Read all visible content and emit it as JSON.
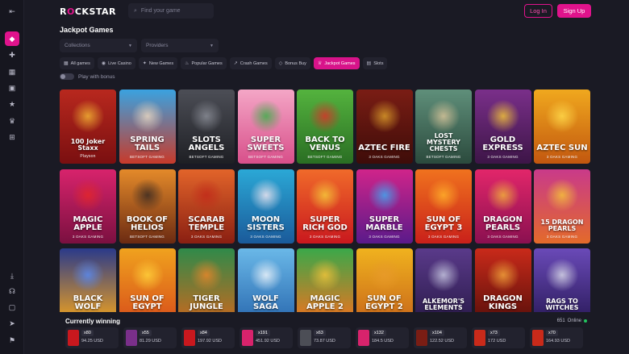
{
  "brand": {
    "logo_before": "R",
    "logo_o": "O",
    "logo_after": "CKSTAR",
    "accent": "#e0138c"
  },
  "header": {
    "search_placeholder": "Find your game",
    "login_label": "Log In",
    "signup_label": "Sign Up"
  },
  "sidebar": {
    "top_icons": [
      "collapse-icon",
      "home-icon",
      "puzzle-icon",
      "grid-icon",
      "gift-icon",
      "star-icon",
      "trophy-icon",
      "cart-icon"
    ],
    "bottom_icons": [
      "download-icon",
      "support-icon",
      "square-icon",
      "send-icon",
      "flag-icon"
    ]
  },
  "page_title": "Jackpot Games",
  "filters": {
    "collections_placeholder": "Collections",
    "providers_placeholder": "Providers"
  },
  "categories": [
    {
      "label": "All games",
      "icon": "grid",
      "active": false
    },
    {
      "label": "Live Casino",
      "icon": "live",
      "active": false
    },
    {
      "label": "New Games",
      "icon": "new",
      "active": false
    },
    {
      "label": "Popular Games",
      "icon": "fire",
      "active": false
    },
    {
      "label": "Crash Games",
      "icon": "crash",
      "active": false
    },
    {
      "label": "Bonus Buy",
      "icon": "diamond",
      "active": false
    },
    {
      "label": "Jackpot Games",
      "icon": "jackpot",
      "active": true
    },
    {
      "label": "Slots",
      "icon": "slots",
      "active": false
    }
  ],
  "bonus_toggle_label": "Play with bonus",
  "games": [
    {
      "name": "100 Joker Staxx",
      "provider": "Playson",
      "bg": "#b8281e",
      "bg2": "#7a0f10",
      "art": "#f2b233",
      "style": "plain"
    },
    {
      "name": "Spring Tails",
      "provider": "BETSOFT GAMING",
      "bg": "#3aa2e0",
      "bg2": "#c83a2a",
      "art": "#e8d6c0",
      "style": ""
    },
    {
      "name": "Slots Angels",
      "provider": "BETSOFT GAMING",
      "bg": "#4c4e56",
      "bg2": "#1e1f24",
      "art": "#8a8d96",
      "style": ""
    },
    {
      "name": "Super Sweets",
      "provider": "BETSOFT GAMING",
      "bg": "#f4a6c6",
      "bg2": "#d84f8a",
      "art": "#3fae4a",
      "style": ""
    },
    {
      "name": "Back to Venus",
      "provider": "BETSOFT GAMING",
      "bg": "#54b33e",
      "bg2": "#2a6e23",
      "art": "#d9332a",
      "style": ""
    },
    {
      "name": "Aztec Fire",
      "provider": "3 OAKS GAMING",
      "bg": "#7a1d14",
      "bg2": "#3e0c09",
      "art": "#d99b2a",
      "style": ""
    },
    {
      "name": "Lost Mystery Chests",
      "provider": "BETSOFT GAMING",
      "bg": "#5f8f7a",
      "bg2": "#2b4a3d",
      "art": "#d7c49a",
      "style": ""
    },
    {
      "name": "Gold Express",
      "provider": "3 OAKS GAMING",
      "bg": "#7a2f8a",
      "bg2": "#3d1547",
      "art": "#f0c23a",
      "style": ""
    },
    {
      "name": "Aztec Sun",
      "provider": "3 OAKS GAMING",
      "bg": "#f0a81e",
      "bg2": "#c2570f",
      "art": "#ffd94a",
      "style": ""
    },
    {
      "name": "Magic Apple",
      "provider": "3 OAKS GAMING",
      "bg": "#d8236c",
      "bg2": "#7a1040",
      "art": "#e3262a",
      "style": ""
    },
    {
      "name": "Book of Helios",
      "provider": "BETSOFT GAMING",
      "bg": "#e48a2a",
      "bg2": "#6b2a12",
      "art": "#3a2a22",
      "style": ""
    },
    {
      "name": "Scarab Temple",
      "provider": "3 OAKS GAMING",
      "bg": "#e2642a",
      "bg2": "#8a1f12",
      "art": "#c22a1a",
      "style": ""
    },
    {
      "name": "Moon Sisters",
      "provider": "3 OAKS GAMING",
      "bg": "#2ba8d6",
      "bg2": "#1a5a9a",
      "art": "#f1e6f0",
      "style": ""
    },
    {
      "name": "Super Rich God",
      "provider": "3 OAKS GAMING",
      "bg": "#f06a2a",
      "bg2": "#c9181e",
      "art": "#f5c93a",
      "style": ""
    },
    {
      "name": "Super Marble",
      "provider": "3 OAKS GAMING",
      "bg": "#d0248a",
      "bg2": "#5a1a8a",
      "art": "#3fa8f0",
      "style": ""
    },
    {
      "name": "Sun of Egypt 3",
      "provider": "3 OAKS GAMING",
      "bg": "#f0721e",
      "bg2": "#c9201a",
      "art": "#ffb02a",
      "style": ""
    },
    {
      "name": "Dragon Pearls",
      "provider": "3 OAKS GAMING",
      "bg": "#e2266a",
      "bg2": "#8a1050",
      "art": "#f0b03a",
      "style": ""
    },
    {
      "name": "15 Dragon Pearls",
      "provider": "3 OAKS GAMING",
      "bg": "#c93a8a",
      "bg2": "#e36a2a",
      "art": "#f5c23a",
      "style": ""
    },
    {
      "name": "Black Wolf",
      "provider": "3 OAKS GAMING",
      "bg": "#2a3a8a",
      "bg2": "#f0a21e",
      "art": "#5a8af0",
      "style": ""
    },
    {
      "name": "Sun of Egypt",
      "provider": "3 OAKS GAMING",
      "bg": "#f0a21e",
      "bg2": "#d8501a",
      "art": "#ffd03a",
      "style": ""
    },
    {
      "name": "Tiger Jungle",
      "provider": "3 OAKS GAMING",
      "bg": "#2f8a4a",
      "bg2": "#c9681e",
      "art": "#e8862a",
      "style": ""
    },
    {
      "name": "Wolf Saga",
      "provider": "3 OAKS GAMING",
      "bg": "#6ab8e8",
      "bg2": "#2a6ab0",
      "art": "#eef4fa",
      "style": ""
    },
    {
      "name": "Magic Apple 2",
      "provider": "3 OAKS GAMING",
      "bg": "#3aa84a",
      "bg2": "#f0721e",
      "art": "#f0c23a",
      "style": ""
    },
    {
      "name": "Sun of Egypt 2",
      "provider": "3 OAKS GAMING",
      "bg": "#f0b21e",
      "bg2": "#c9681a",
      "art": "#e89a2a",
      "style": ""
    },
    {
      "name": "Alkemor's Elements",
      "provider": "3 OAKS GAMING",
      "bg": "#5a3a8a",
      "bg2": "#2a1a4a",
      "art": "#c6c6e0",
      "style": ""
    },
    {
      "name": "Dragon Kings",
      "provider": "3 OAKS GAMING",
      "bg": "#c92a1a",
      "bg2": "#5a0f0a",
      "art": "#f0a23a",
      "style": ""
    },
    {
      "name": "Rags to Witches",
      "provider": "3 OAKS GAMING",
      "bg": "#6a4ab8",
      "bg2": "#2a1a5a",
      "art": "#d8d8e8",
      "style": ""
    }
  ],
  "winning": {
    "title": "Currently winning",
    "online_count": "651",
    "online_label": "Online",
    "items": [
      {
        "mult": "x80",
        "amount": "94.25 USD",
        "color": "#c9181e"
      },
      {
        "mult": "x55",
        "amount": "81.29 USD",
        "color": "#7a2f8a"
      },
      {
        "mult": "x84",
        "amount": "197.92 USD",
        "color": "#c9181e"
      },
      {
        "mult": "x191",
        "amount": "451.92 USD",
        "color": "#d8236c"
      },
      {
        "mult": "x63",
        "amount": "73.87 USD",
        "color": "#4c4e56"
      },
      {
        "mult": "x132",
        "amount": "184.5 USD",
        "color": "#d8236c"
      },
      {
        "mult": "x104",
        "amount": "122.52 USD",
        "color": "#7a1d14"
      },
      {
        "mult": "x73",
        "amount": "172 USD",
        "color": "#c92a1a"
      },
      {
        "mult": "x70",
        "amount": "164.93 USD",
        "color": "#c92a1a"
      }
    ]
  }
}
